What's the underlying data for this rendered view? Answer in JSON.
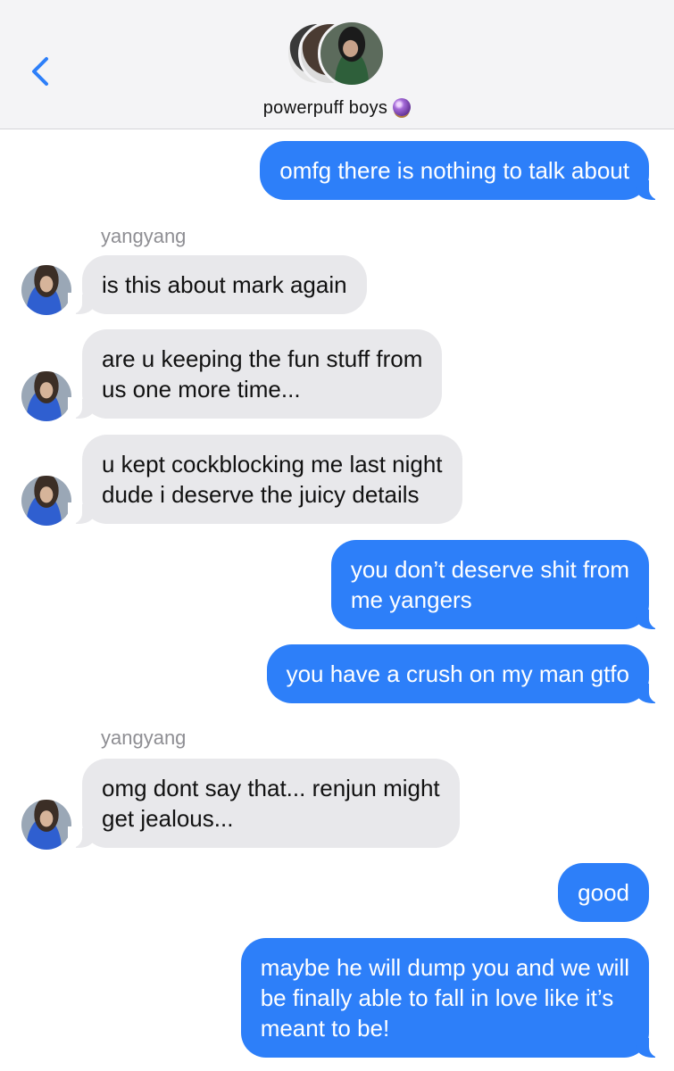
{
  "header": {
    "group_name": "powerpuff boys",
    "back_icon": "chevron-left-icon",
    "emoji_icon": "crystal-ball-icon"
  },
  "colors": {
    "outgoing": "#2d7ff9",
    "incoming": "#e8e8eb"
  },
  "messages": [
    {
      "from": "me",
      "text": "omfg there is nothing to talk about"
    },
    {
      "sender_label": "yangyang"
    },
    {
      "from": "yangyang",
      "text": "is this about mark again"
    },
    {
      "from": "yangyang",
      "lines": [
        "are u keeping the fun stuff from",
        "us one more time..."
      ]
    },
    {
      "from": "yangyang",
      "lines": [
        "u kept cockblocking me last night",
        "dude i deserve the juicy details"
      ]
    },
    {
      "from": "me",
      "lines": [
        "you don’t deserve shit from",
        "me yangers"
      ]
    },
    {
      "from": "me",
      "text": "you have a crush on my man gtfo"
    },
    {
      "sender_label": "yangyang"
    },
    {
      "from": "yangyang",
      "lines": [
        "omg dont say that... renjun might",
        "get jealous..."
      ]
    },
    {
      "from": "me",
      "text": "good"
    },
    {
      "from": "me",
      "lines": [
        "maybe he will dump you and we will",
        "be finally able to fall in love like it’s",
        "meant to be!"
      ]
    }
  ]
}
